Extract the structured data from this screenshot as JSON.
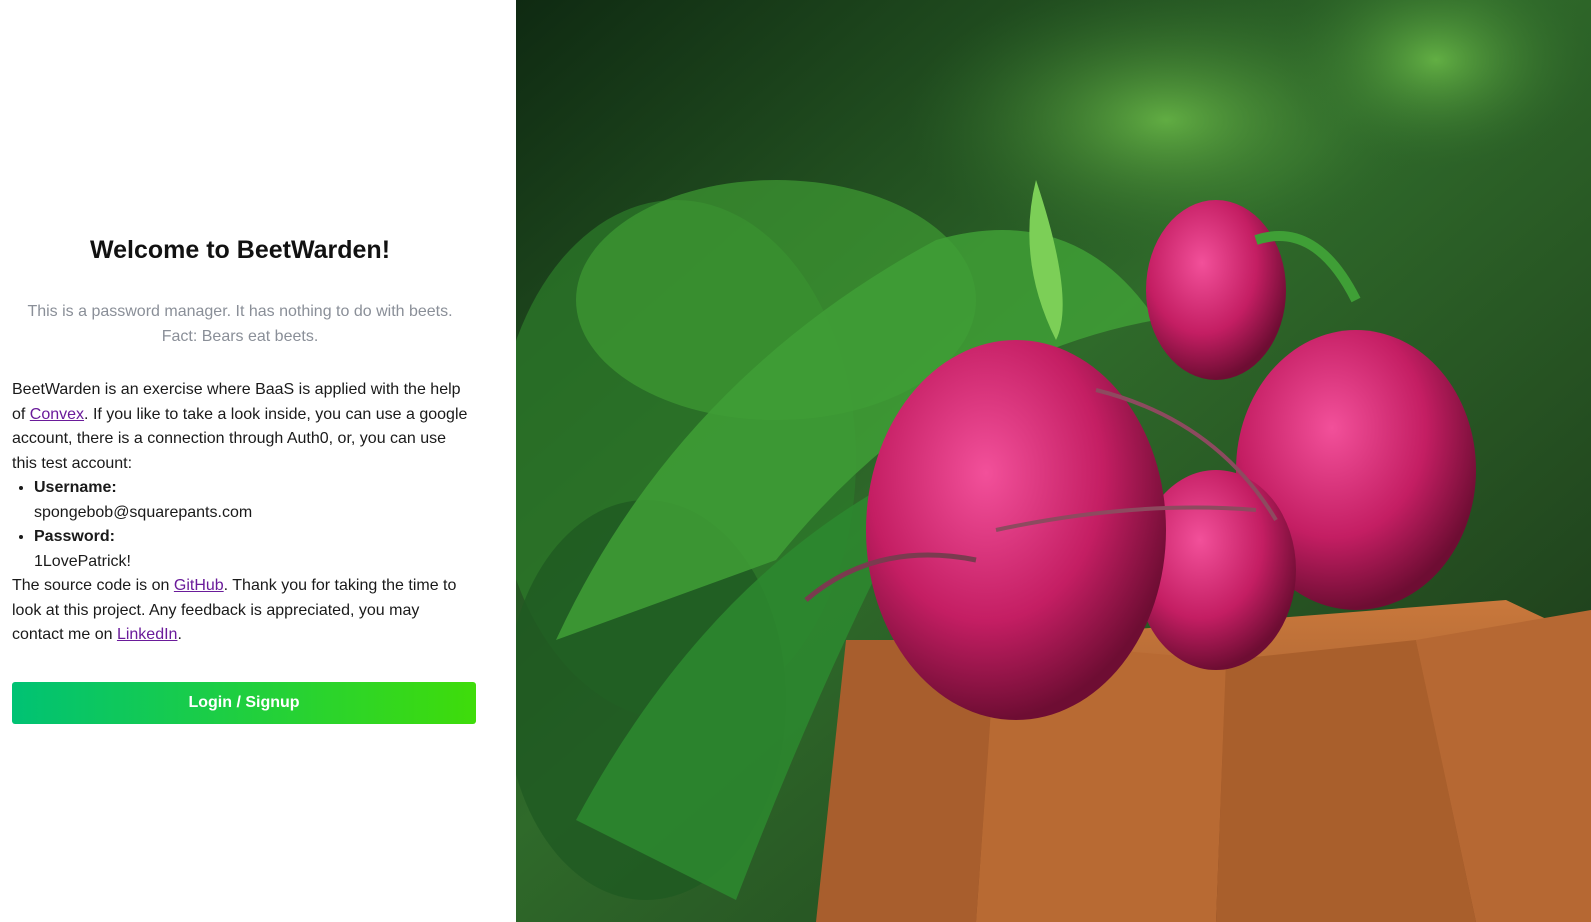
{
  "welcome": {
    "title": "Welcome to BeetWarden!",
    "subtitle_line1": "This is a password manager. It has nothing to do with beets.",
    "subtitle_line2": "Fact: Bears eat beets."
  },
  "intro": {
    "text_before_link": "BeetWarden is an exercise where BaaS is applied with the help of ",
    "convex_link": "Convex",
    "text_after_link": ". If you like to take a look inside, you can use a google account, there is a connection through Auth0, or, you can use this test account:"
  },
  "credentials": {
    "username_label": "Username:",
    "username_value": "spongebob@squarepants.com",
    "password_label": "Password:",
    "password_value": "1LovePatrick!"
  },
  "footer_text": {
    "before_github": "The source code is on ",
    "github_link": "GitHub",
    "middle": ". Thank you for taking the time to look at this project. Any feedback is appreciated, you may contact me on ",
    "linkedin_link": "LinkedIn",
    "end": "."
  },
  "login_button_label": "Login / Signup",
  "colors": {
    "button_gradient_start": "#00c274",
    "button_gradient_end": "#3fdc0a",
    "link": "#6a1b9a",
    "subtitle": "#8a8f98"
  }
}
